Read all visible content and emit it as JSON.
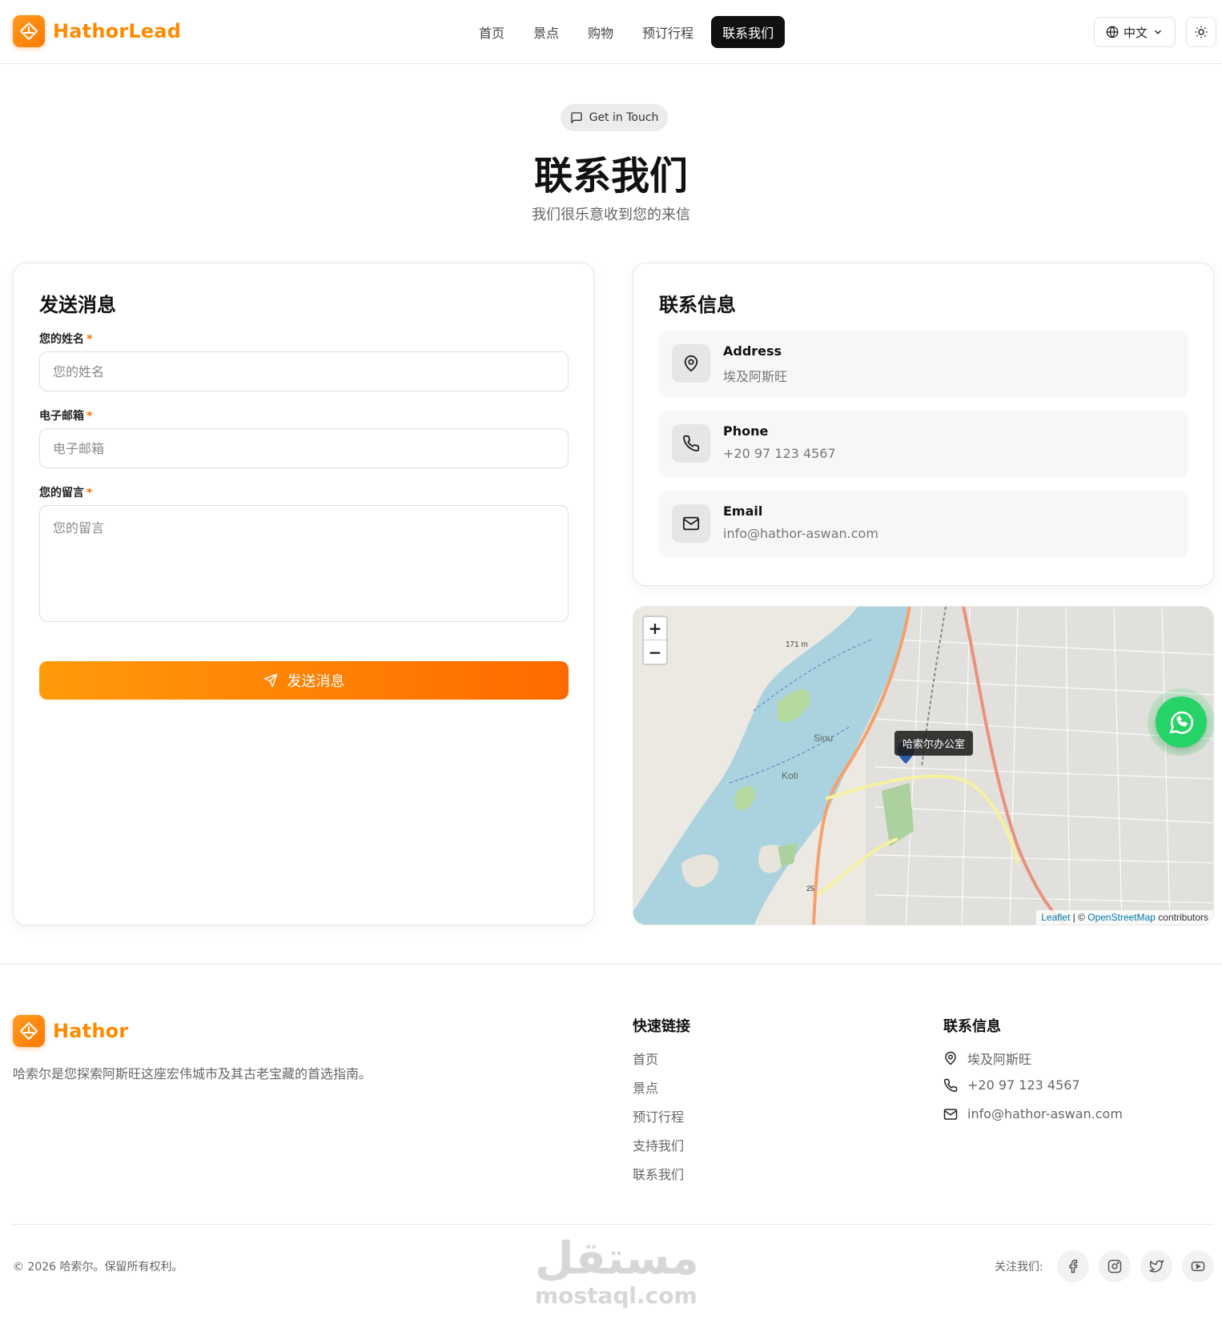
{
  "header": {
    "brand": "HathorLead",
    "nav": [
      {
        "label": "首页"
      },
      {
        "label": "景点"
      },
      {
        "label": "购物"
      },
      {
        "label": "预订行程"
      },
      {
        "label": "联系我们",
        "active": true
      }
    ],
    "language": "中文",
    "accent_color": "#ff8a00"
  },
  "hero": {
    "badge": "Get in Touch",
    "title": "联系我们",
    "subtitle": "我们很乐意收到您的来信"
  },
  "form": {
    "title": "发送消息",
    "name_label": "您的姓名",
    "name_placeholder": "您的姓名",
    "email_label": "电子邮箱",
    "email_placeholder": "电子邮箱",
    "message_label": "您的留言",
    "message_placeholder": "您的留言",
    "required_mark": "*",
    "submit": "发送消息"
  },
  "contact_info": {
    "title": "联系信息",
    "items": [
      {
        "label": "Address",
        "value": "埃及阿斯旺",
        "icon": "map-pin-icon"
      },
      {
        "label": "Phone",
        "value": "+20 97 123 4567",
        "icon": "phone-icon"
      },
      {
        "label": "Email",
        "value": "info@hathor-aswan.com",
        "icon": "mail-icon"
      }
    ]
  },
  "map": {
    "zoom_in": "+",
    "zoom_out": "−",
    "marker_tooltip": "哈索尔办公室",
    "labels": {
      "elevation": "171 m",
      "siou": "Siou",
      "koti": "Koti",
      "road": "25"
    },
    "attribution_leaflet": "Leaflet",
    "attribution_sep": " | © ",
    "attribution_osm": "OpenStreetMap",
    "attribution_tail": " contributors"
  },
  "footer": {
    "brand": "Hathor",
    "description": "哈索尔是您探索阿斯旺这座宏伟城市及其古老宝藏的首选指南。",
    "links_title": "快速链接",
    "links": [
      "首页",
      "景点",
      "预订行程",
      "支持我们",
      "联系我们"
    ],
    "contact_title": "联系信息",
    "contact": [
      "埃及阿斯旺",
      "+20 97 123 4567",
      "info@hathor-aswan.com"
    ],
    "copyright": "© 2026 哈索尔。保留所有权利。",
    "follow": "关注我们:",
    "social": [
      "facebook-icon",
      "instagram-icon",
      "twitter-icon",
      "youtube-icon"
    ]
  },
  "watermark": {
    "arabic": "مستقل",
    "latin": "mostaql.com"
  }
}
